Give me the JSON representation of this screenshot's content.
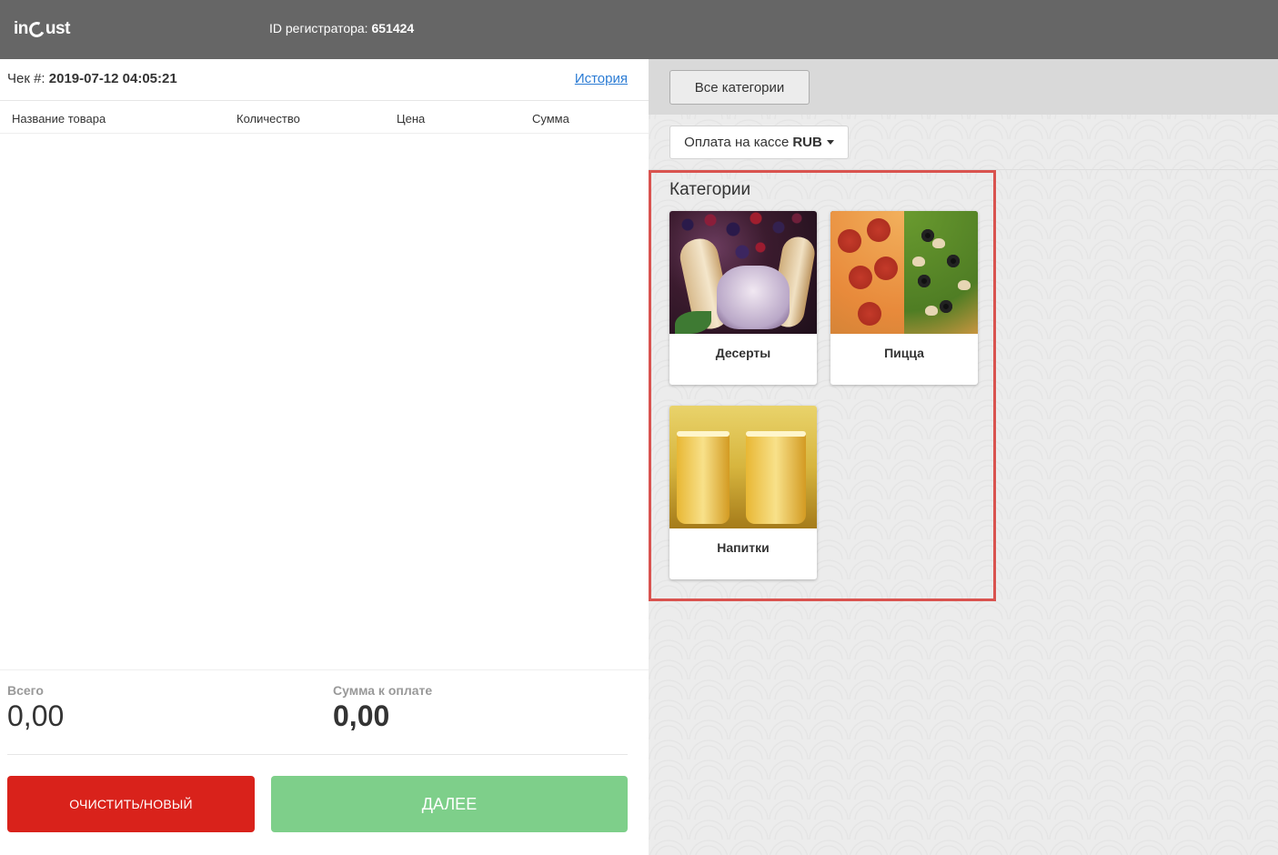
{
  "header": {
    "logo_text": "incust",
    "reg_id_label": "ID регистратора:",
    "reg_id_value": "651424"
  },
  "receipt": {
    "label": "Чек #:",
    "value": "2019-07-12 04:05:21",
    "history_link": "История"
  },
  "table": {
    "columns": [
      "Название товара",
      "Количество",
      "Цена",
      "Сумма"
    ],
    "rows": []
  },
  "totals": {
    "total_label": "Всего",
    "total_value": "0,00",
    "pay_label": "Сумма к оплате",
    "pay_value": "0,00"
  },
  "actions": {
    "clear_label": "ОЧИСТИТЬ/НОВЫЙ",
    "next_label": "ДАЛЕЕ"
  },
  "right": {
    "all_categories_label": "Все категории",
    "payment_label": "Оплата на кассе",
    "payment_currency": "RUB",
    "categories_title": "Категории",
    "categories": [
      {
        "name": "Десерты"
      },
      {
        "name": "Пицца"
      },
      {
        "name": "Напитки"
      }
    ]
  },
  "colors": {
    "header_bg": "#666666",
    "clear_button": "#d9221b",
    "next_button": "#7ecf8a",
    "highlight_border": "#d9534f",
    "link": "#2a7bd4"
  }
}
